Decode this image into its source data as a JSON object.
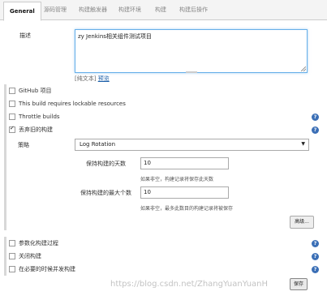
{
  "tabs": [
    "General",
    "源码管理",
    "构建触发器",
    "构建环境",
    "构建",
    "构建后操作"
  ],
  "description": {
    "label": "描述",
    "value": "zy Jenkins相关组件测试项目",
    "plain_text_link": "[纯文本]",
    "preview_link": "预览"
  },
  "options": {
    "github_project": "GitHub 项目",
    "lockable": "This build requires lockable resources",
    "throttle": "Throttle builds",
    "discard_old": "丢弃旧的构建"
  },
  "strategy": {
    "label": "策略",
    "selected": "Log Rotation",
    "days_label": "保持构建的天数",
    "days_value": "10",
    "days_hint": "如果非空，构建记录将保存此天数",
    "max_label": "保持构建的最大个数",
    "max_value": "10",
    "max_hint": "如果非空，最多此数目的构建记录将被保存",
    "advanced_button": "高级..."
  },
  "more_options": {
    "parameterized": "参数化构建过程",
    "disable": "关闭构建",
    "concurrent": "在必要的时候并发构建"
  },
  "save_button": "保存",
  "watermark": "https://blog.csdn.net/ZhangYuanYuanH",
  "help_symbol": "?",
  "colors": {
    "link": "#1a5ea8",
    "help": "#3b6fb6",
    "focus": "#66afe9"
  }
}
